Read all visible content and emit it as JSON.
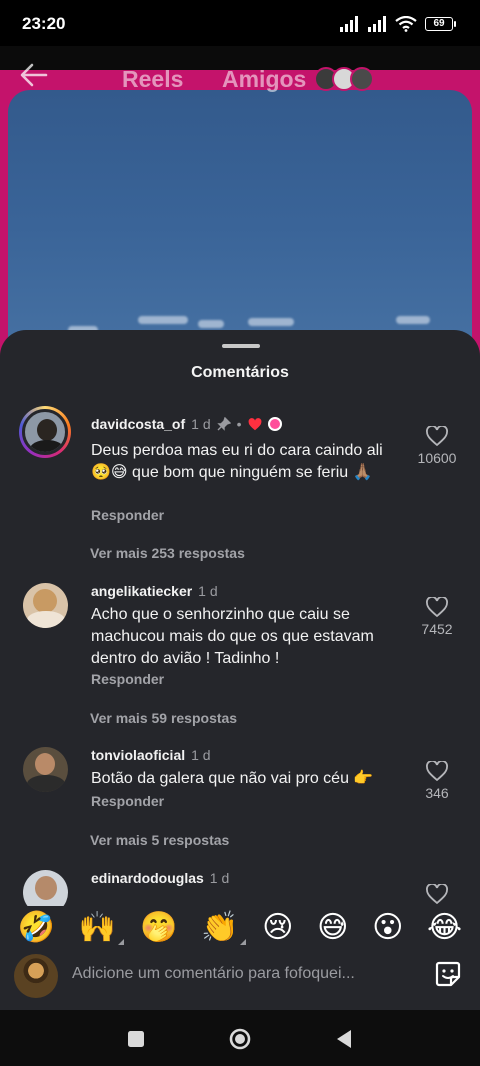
{
  "status_bar": {
    "time": "23:20",
    "battery": "69",
    "icons": [
      "signal-icon",
      "signal-icon",
      "wifi-icon",
      "battery-icon"
    ]
  },
  "header": {
    "tabs": [
      {
        "label": "Reels"
      },
      {
        "label": "Amigos"
      }
    ]
  },
  "comments_sheet": {
    "title": "Comentários",
    "comments": [
      {
        "username": "davidcosta_of",
        "time": "1 d",
        "pinned": true,
        "creator_liked": true,
        "text": "Deus perdoa mas eu ri do cara caindo ali 🥺😅 que bom que ninguém se feriu 🙏🏽",
        "reply_label": "Responder",
        "more_replies": "Ver mais 253 respostas",
        "likes": "10600"
      },
      {
        "username": "angelikatiecker",
        "time": "1 d",
        "text": "Acho que o senhorzinho que caiu se machucou mais do que os que estavam dentro do avião ! Tadinho !",
        "reply_label": "Responder",
        "more_replies": "Ver mais 59 respostas",
        "likes": "7452"
      },
      {
        "username": "tonviolaoficial",
        "time": "1 d",
        "text": "Botão da galera que não vai pro céu 👉",
        "reply_label": "Responder",
        "more_replies": "Ver mais 5 respostas",
        "likes": "346"
      },
      {
        "username": "edinardodouglas",
        "time": "1 d"
      }
    ]
  },
  "reactions": [
    "🤣",
    "🙌",
    "🤭",
    "👏",
    "😢",
    "😅",
    "😮",
    "😂"
  ],
  "composer": {
    "placeholder": "Adicione um comentário para fofoquei..."
  },
  "colors": {
    "sheet_bg": "#25262b",
    "accent_magenta": "#c4136b",
    "like_red": "#ff3040"
  }
}
